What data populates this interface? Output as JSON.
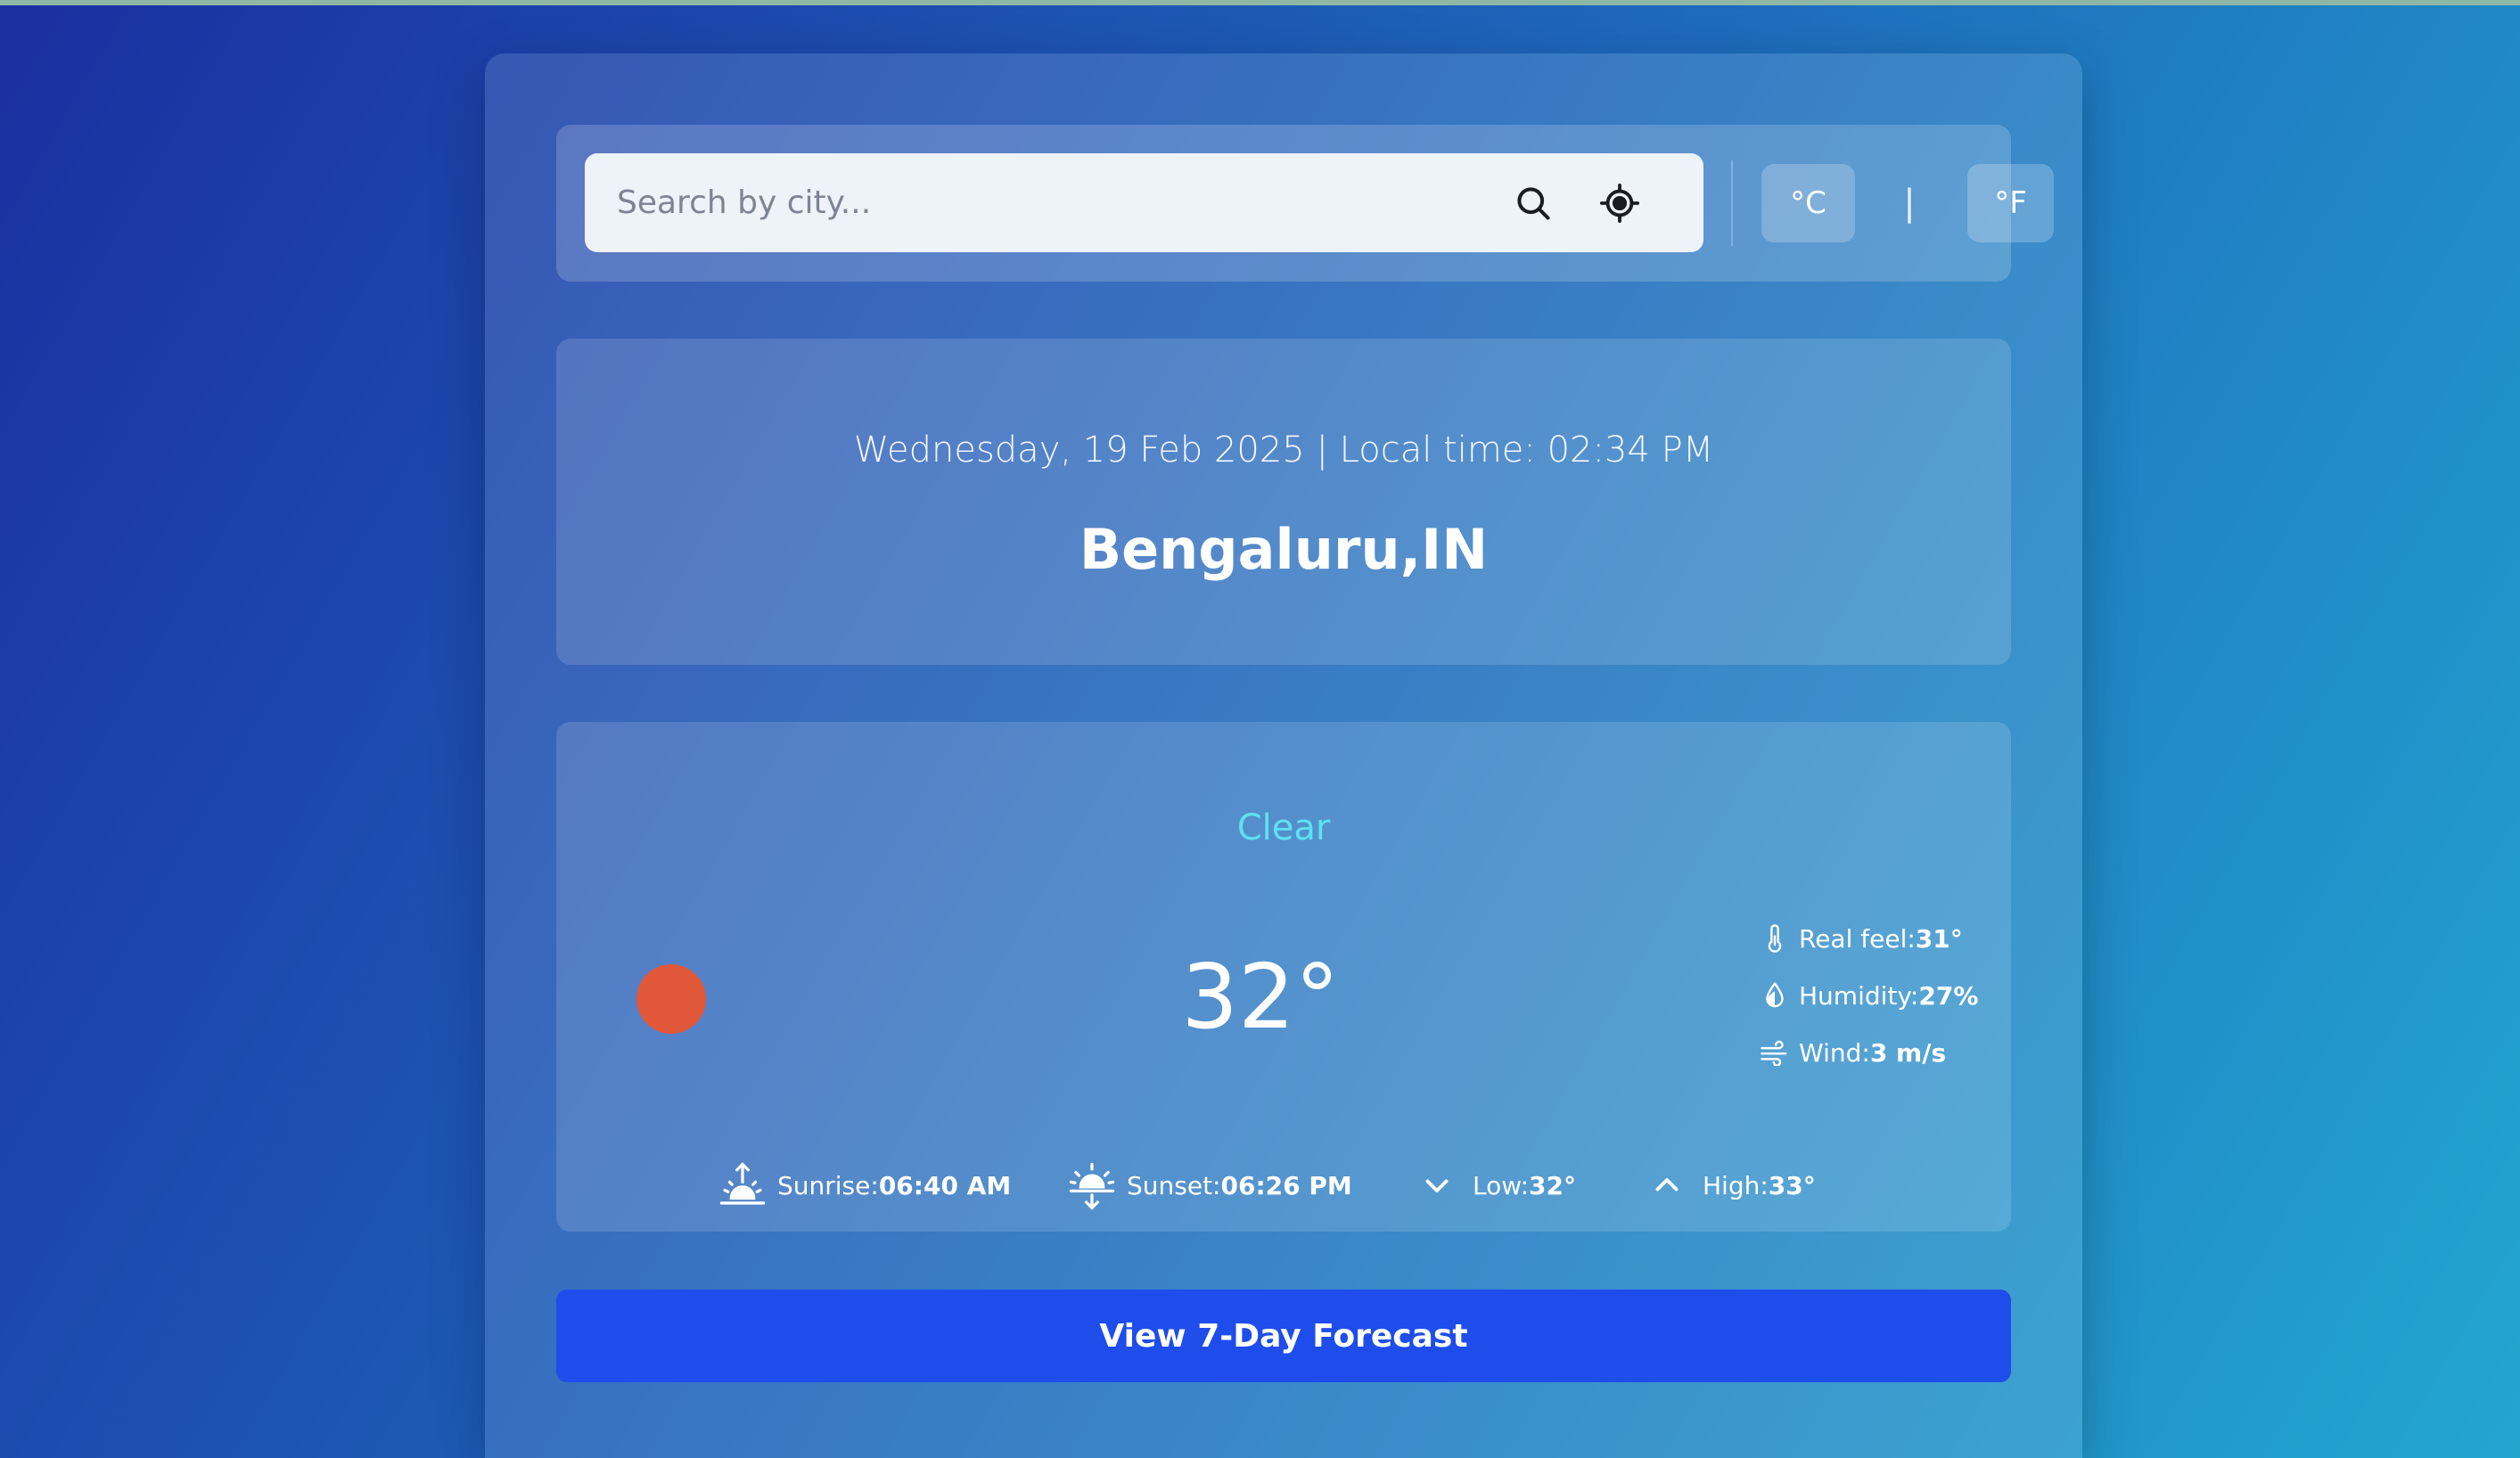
{
  "search": {
    "placeholder": "Search by city...",
    "value": "",
    "search_icon": "search-icon",
    "locate_icon": "location-crosshair-icon"
  },
  "units": {
    "celsius_label": "°C",
    "separator": "|",
    "fahrenheit_label": "°F"
  },
  "location": {
    "datetime": "Wednesday, 19 Feb 2025 | Local time: 02:34 PM",
    "city": "Bengaluru,IN"
  },
  "weather": {
    "condition": "Clear",
    "temperature": "32°",
    "icon": "sun-icon",
    "icon_color": "#e0573a",
    "condition_color": "#5fe0f4",
    "details": [
      {
        "label": "Real feel: ",
        "value": "31°",
        "icon": "thermometer-icon"
      },
      {
        "label": "Humidity: ",
        "value": "27%",
        "icon": "droplet-icon"
      },
      {
        "label": "Wind: ",
        "value": "3 m/s",
        "icon": "wind-icon"
      }
    ],
    "stats": [
      {
        "label": "Sunrise: ",
        "value": "06:40 AM",
        "icon": "sunrise-icon"
      },
      {
        "label": "Sunset: ",
        "value": "06:26 PM",
        "icon": "sunset-icon"
      },
      {
        "label": "Low: ",
        "value": "32°",
        "icon": "chevron-down-icon"
      },
      {
        "label": "High: ",
        "value": "33°",
        "icon": "chevron-up-icon"
      }
    ]
  },
  "forecast_button": {
    "label": "View 7-Day Forecast",
    "color": "#1e4deb"
  }
}
